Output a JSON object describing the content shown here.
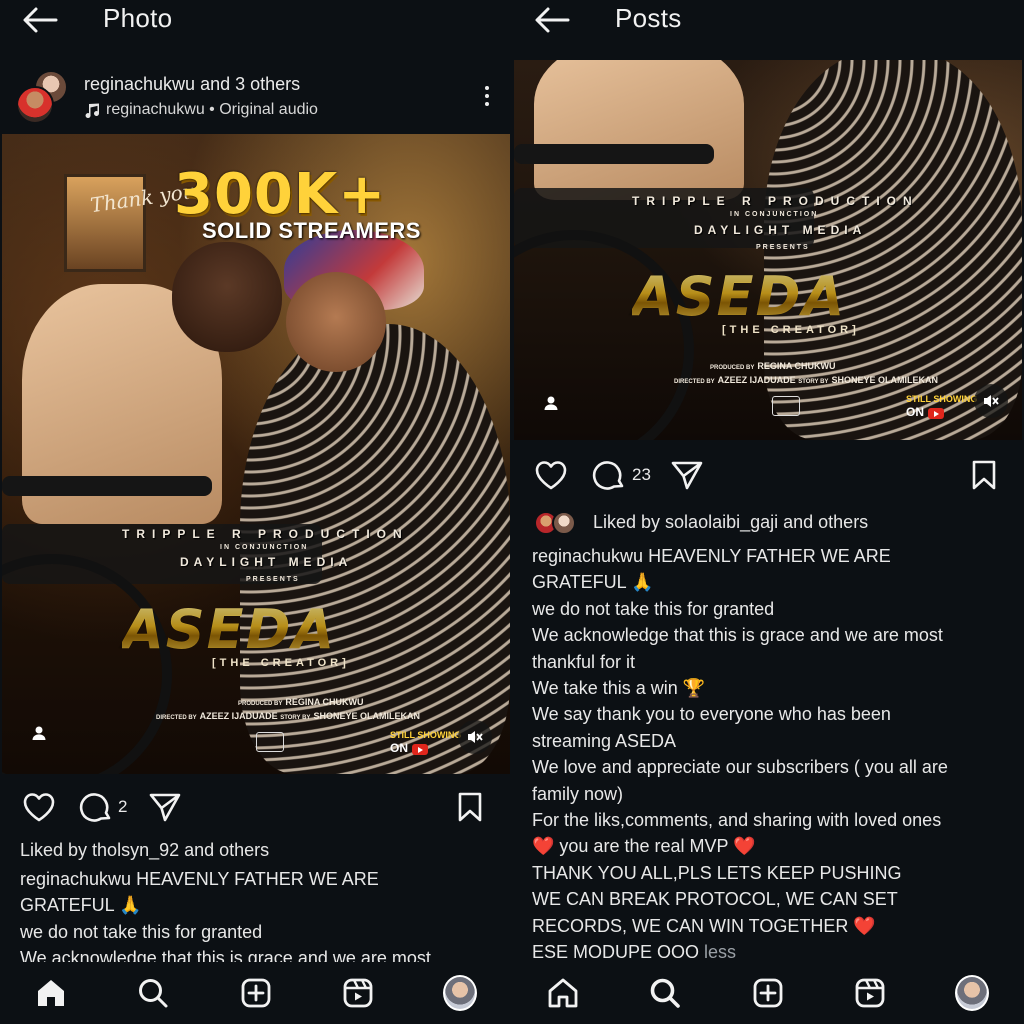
{
  "left": {
    "title": "Photo",
    "post": {
      "user_line": "reginachukwu and 3 others",
      "audio_line": "reginachukwu • Original audio"
    },
    "poster": {
      "thanks": "Thank you",
      "big": "300K+",
      "solid": "SOLID STREAMERS",
      "company": "TRIPPLE R PRODUCTION",
      "in_conj": "IN CONJUNCTION",
      "media": "DAYLIGHT MEDIA",
      "presents": "PRESENTS",
      "title": "ASEDA",
      "subtitle": "[THE CREATOR]",
      "produced_by_label": "PRODUCED BY",
      "produced_by": "REGINA CHUKWU",
      "directed_by_label": "DIRECTED BY",
      "directed_by": "AZEEZ IJADUADE",
      "story_by_label": "STORY BY",
      "story_by": "SHONEYE OLAMILEKAN",
      "still_showing": "STILL SHOWING",
      "on": "ON"
    },
    "comment_count": "2",
    "likes": "Liked by tholsyn_92 and others",
    "caption": [
      "reginachukwu HEAVENLY FATHER WE ARE",
      "GRATEFUL 🙏",
      "we do not take this for granted",
      "We acknowledge that this is grace and we are most"
    ]
  },
  "right": {
    "title": "Posts",
    "comment_count": "23",
    "likes": "Liked by solaolaibi_gaji and others",
    "caption": [
      "reginachukwu HEAVENLY FATHER WE ARE",
      "GRATEFUL 🙏",
      "we do not take this for granted",
      "We acknowledge that this is grace and we are most",
      "thankful for it",
      "We take this a win 🏆",
      "We say thank you to everyone who has been",
      "streaming ASEDA",
      "We love and appreciate our subscribers ( you all are",
      "family now)",
      "For the liks,comments, and sharing with loved ones",
      "❤️ you are the real MVP ❤️",
      "THANK YOU ALL,PLS LETS KEEP PUSHING",
      "WE CAN BREAK PROTOCOL, WE CAN SET",
      "RECORDS, WE CAN WIN TOGETHER ❤️"
    ],
    "caption_last": "ESE MODUPE OOO",
    "less": "less"
  },
  "icons": {
    "back": "back-arrow-icon",
    "more": "more-vertical-icon",
    "like": "heart-icon",
    "comment": "comment-icon",
    "share": "send-icon",
    "save": "bookmark-icon",
    "home": "home-icon",
    "search": "search-icon",
    "create": "create-plus-icon",
    "reels": "reels-icon",
    "profile": "profile-avatar"
  },
  "colors": {
    "background": "#0c1014",
    "text": "#f5f5f5",
    "poster_gold": "#ffd23a"
  }
}
